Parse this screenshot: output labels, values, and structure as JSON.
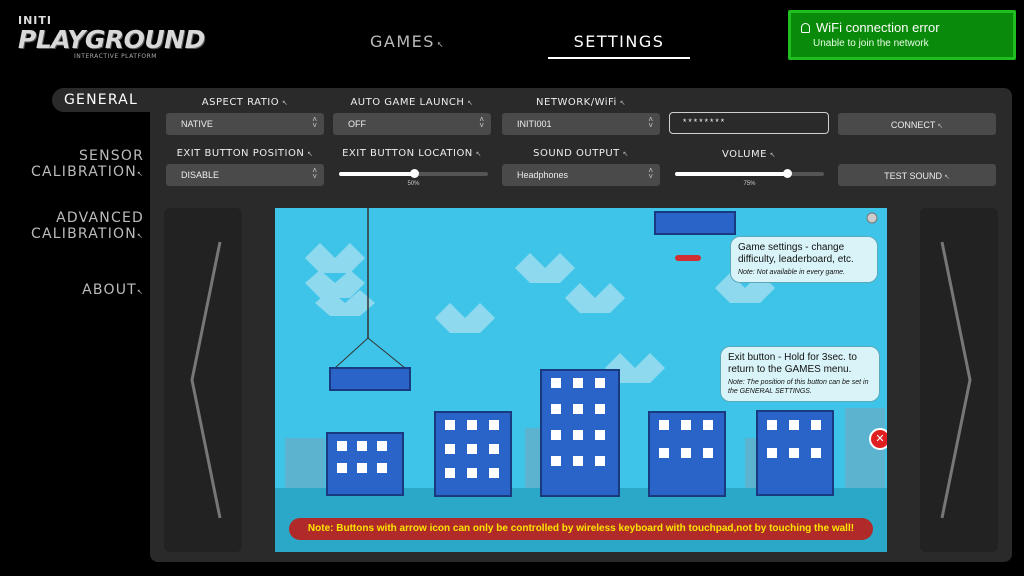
{
  "logo": {
    "small": "INITI",
    "big": "PLAYGROUND",
    "sub": "INTERACTIVE PLATFORM"
  },
  "nav": {
    "games": "GAMES",
    "settings": "SETTINGS"
  },
  "toast": {
    "title": "WiFi connection error",
    "message": "Unable to join the network",
    "color": "#0a8a0a"
  },
  "sidebar": {
    "items": [
      {
        "label": "GENERAL"
      },
      {
        "label1": "SENSOR",
        "label2": "CALIBRATION"
      },
      {
        "label1": "ADVANCED",
        "label2": "CALIBRATION"
      },
      {
        "label": "ABOUT"
      }
    ]
  },
  "settings": {
    "aspect_ratio": {
      "label": "ASPECT RATIO",
      "value": "NATIVE"
    },
    "auto_game_launch": {
      "label": "AUTO GAME LAUNCH",
      "value": "OFF"
    },
    "network": {
      "label": "NETWORK/WiFi",
      "value": "INITI001",
      "password": "********"
    },
    "connect_button": "CONNECT",
    "exit_button_position": {
      "label": "EXIT BUTTON POSITION",
      "value": "DISABLE"
    },
    "exit_button_location": {
      "label": "EXIT BUTTON LOCATION",
      "value": 0.5,
      "display": "50%"
    },
    "sound_output": {
      "label": "SOUND OUTPUT",
      "value": "Headphones"
    },
    "volume": {
      "label": "VOLUME",
      "value": 0.75,
      "display": "75%"
    },
    "test_sound_button": "TEST SOUND"
  },
  "preview": {
    "bubble_settings": {
      "text": "Game settings - change difficulty, leaderboard, etc.",
      "note": "Note: Not available in every game."
    },
    "bubble_exit": {
      "text": "Exit button - Hold for 3sec. to return to the GAMES menu.",
      "note": "Note: The position of this button can be set in the GENERAL SETTINGS."
    },
    "note_bar": "Note: Buttons with arrow icon  can only be controlled by wireless keyboard with touchpad,not by touching the wall!",
    "exit_icon": "close-icon"
  },
  "colors": {
    "accent": "#1fbf1f",
    "panel": "#2a2a2a",
    "sky": "#3ec4e8"
  }
}
